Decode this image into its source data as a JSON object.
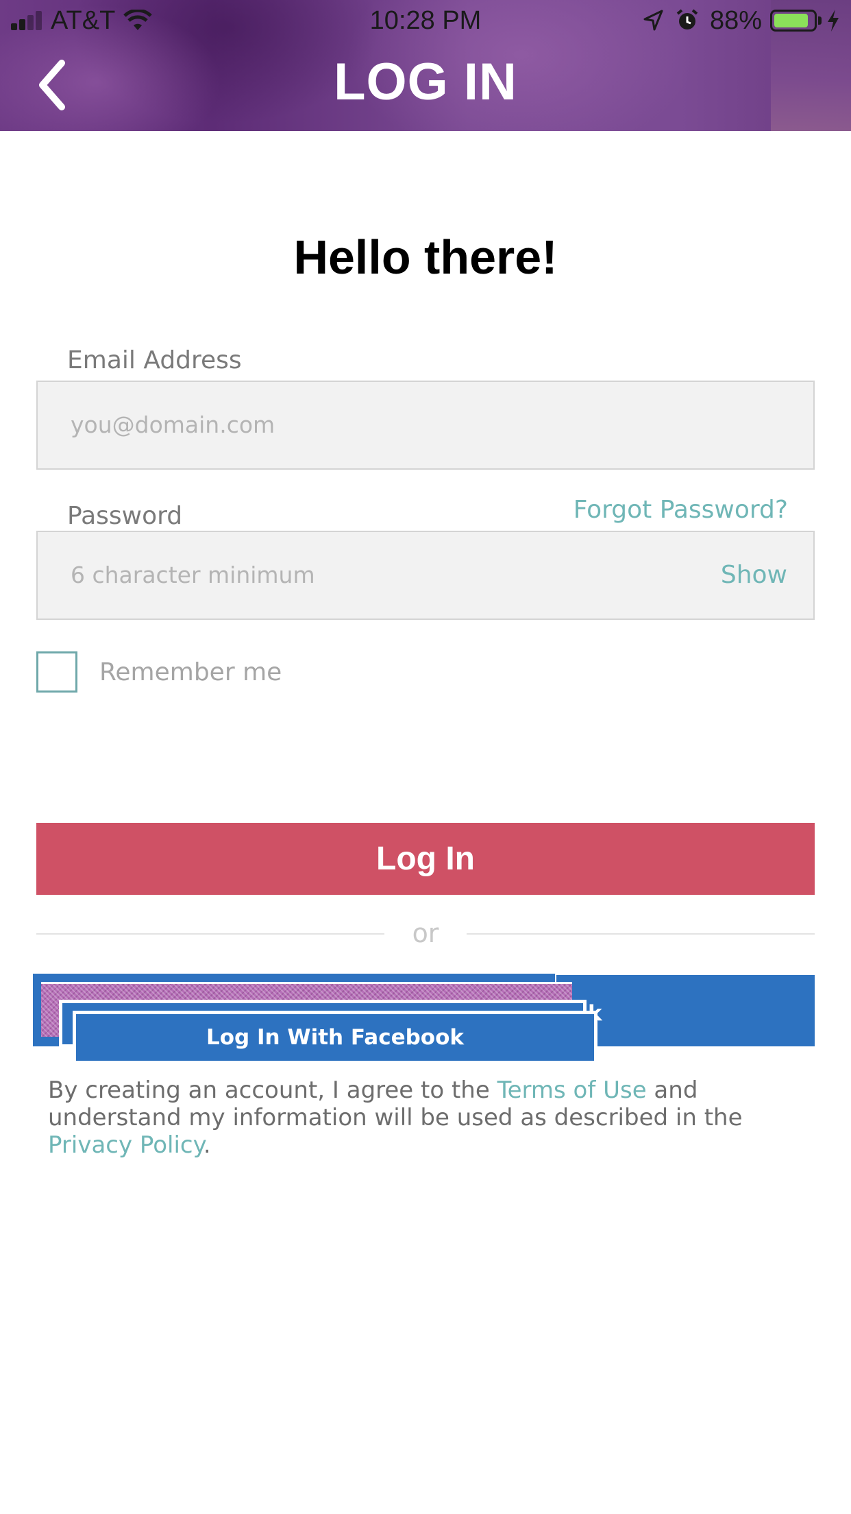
{
  "status_bar": {
    "carrier": "AT&T",
    "time": "10:28 PM",
    "battery_percent": "88%",
    "battery_level": 0.88,
    "battery_color": "#8be05a"
  },
  "header": {
    "title": "LOG IN",
    "back_icon": "chevron-left-icon"
  },
  "greeting": "Hello there!",
  "email": {
    "label": "Email Address",
    "value": "",
    "placeholder": "you@domain.com"
  },
  "password": {
    "label": "Password",
    "value": "",
    "placeholder": "6 character minimum",
    "show_label": "Show",
    "forgot_label": "Forgot Password?"
  },
  "remember_me": {
    "label": "Remember me",
    "checked": false
  },
  "login_button": {
    "label": "Log In",
    "color": "#cf5165"
  },
  "divider_text": "or",
  "facebook_button": {
    "label": "Log In With Facebook",
    "color": "#2d72c0",
    "residual_glyph": "k"
  },
  "legal": {
    "prefix": "By creating an account, I agree to the ",
    "terms_link": "Terms of Use",
    "middle": " and understand my information will be used as described in the ",
    "privacy_link": "Privacy Policy",
    "suffix": "."
  },
  "colors": {
    "accent_teal": "#6fb6b6",
    "header_purple": "#6e3b86"
  }
}
